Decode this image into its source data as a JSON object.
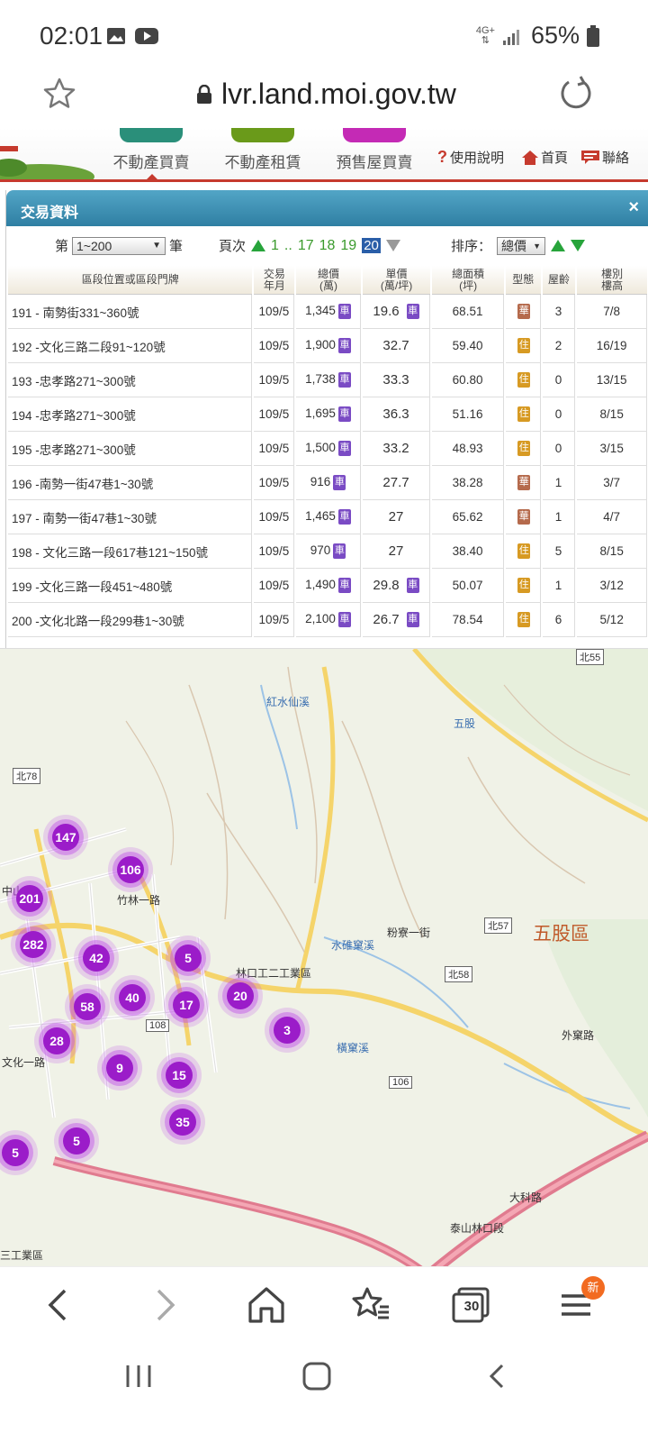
{
  "status": {
    "time": "02:01",
    "network": "4G+",
    "battery": "65%"
  },
  "browser": {
    "url": "lvr.land.moi.gov.tw",
    "tabs_count": "30",
    "new_badge": "新"
  },
  "header": {
    "tabs": [
      {
        "label": "不動產買賣",
        "color": "#2a8f7a"
      },
      {
        "label": "不動產租賃",
        "color": "#6a9a1a"
      },
      {
        "label": "預售屋買賣",
        "color": "#c42ab5"
      }
    ],
    "help_label": "使用說明",
    "home_label": "首頁",
    "contact_label": "聯絡"
  },
  "panel": {
    "title": "交易資料",
    "close": "×",
    "range_prefix": "第",
    "range_value": "1~200",
    "range_suffix": "筆",
    "page_label": "頁次",
    "pages": [
      "1",
      "..",
      "17",
      "18",
      "19"
    ],
    "current_page": "20",
    "sort_label": "排序：",
    "sort_value": "總價"
  },
  "table": {
    "headers": {
      "addr": "區段位置或區段門牌",
      "date": [
        "交易",
        "年月"
      ],
      "total": [
        "總價",
        "(萬)"
      ],
      "unit": [
        "單價",
        "(萬/坪)"
      ],
      "area": [
        "總面積",
        "(坪)"
      ],
      "type": "型態",
      "age": "屋齡",
      "floor": [
        "樓別",
        "樓高"
      ]
    },
    "rows": [
      {
        "addr": "191 - 南勢街331~360號",
        "date": "109/5",
        "total": "1,345",
        "unit": "19.6",
        "unit_car": true,
        "area": "68.51",
        "type": "華",
        "age": "3",
        "floor": "7/8"
      },
      {
        "addr": "192 -文化三路二段91~120號",
        "date": "109/5",
        "total": "1,900",
        "unit": "32.7",
        "unit_car": false,
        "area": "59.40",
        "type": "住",
        "age": "2",
        "floor": "16/19"
      },
      {
        "addr": "193 -忠孝路271~300號",
        "date": "109/5",
        "total": "1,738",
        "unit": "33.3",
        "unit_car": false,
        "area": "60.80",
        "type": "住",
        "age": "0",
        "floor": "13/15"
      },
      {
        "addr": "194 -忠孝路271~300號",
        "date": "109/5",
        "total": "1,695",
        "unit": "36.3",
        "unit_car": false,
        "area": "51.16",
        "type": "住",
        "age": "0",
        "floor": "8/15"
      },
      {
        "addr": "195 -忠孝路271~300號",
        "date": "109/5",
        "total": "1,500",
        "unit": "33.2",
        "unit_car": false,
        "area": "48.93",
        "type": "住",
        "age": "0",
        "floor": "3/15"
      },
      {
        "addr": "196 -南勢一街47巷1~30號",
        "date": "109/5",
        "total": "916",
        "unit": "27.7",
        "unit_car": false,
        "area": "38.28",
        "type": "華",
        "age": "1",
        "floor": "3/7"
      },
      {
        "addr": "197 - 南勢一街47巷1~30號",
        "date": "109/5",
        "total": "1,465",
        "unit": "27",
        "unit_car": false,
        "area": "65.62",
        "type": "華",
        "age": "1",
        "floor": "4/7"
      },
      {
        "addr": "198 - 文化三路一段617巷121~150號",
        "date": "109/5",
        "total": "970",
        "unit": "27",
        "unit_car": false,
        "area": "38.40",
        "type": "住",
        "age": "5",
        "floor": "8/15"
      },
      {
        "addr": "199 -文化三路一段451~480號",
        "date": "109/5",
        "total": "1,490",
        "unit": "29.8",
        "unit_car": true,
        "area": "50.07",
        "type": "住",
        "age": "1",
        "floor": "3/12"
      },
      {
        "addr": "200 -文化北路一段299巷1~30號",
        "date": "109/5",
        "total": "2,100",
        "unit": "26.7",
        "unit_car": true,
        "area": "78.54",
        "type": "住",
        "age": "6",
        "floor": "5/12"
      }
    ],
    "car_badge": "車"
  },
  "map": {
    "district": "五股區",
    "labels": {
      "industrial": "林口工二工業區",
      "industrial2": "三工業區",
      "road_zhulin": "竹林一路",
      "road_zhongshan": "中山路",
      "road_wenhua": "文化一路",
      "road_fenliao": "粉寮一街",
      "river_hongshui": "紅水仙溪",
      "river_shuiniang": "水碓窠溪",
      "river_heng": "橫窠溪",
      "road_waike": "外窠路",
      "road_dake": "大科路",
      "highway": "泰山林口段",
      "road_wugu": "五股"
    },
    "road_tags": [
      "北55",
      "北78",
      "北57",
      "北58",
      "108",
      "106"
    ],
    "clusters": [
      "147",
      "106",
      "201",
      "282",
      "42",
      "5",
      "58",
      "40",
      "17",
      "20",
      "3",
      "28",
      "9",
      "15",
      "35",
      "5",
      "5"
    ]
  }
}
